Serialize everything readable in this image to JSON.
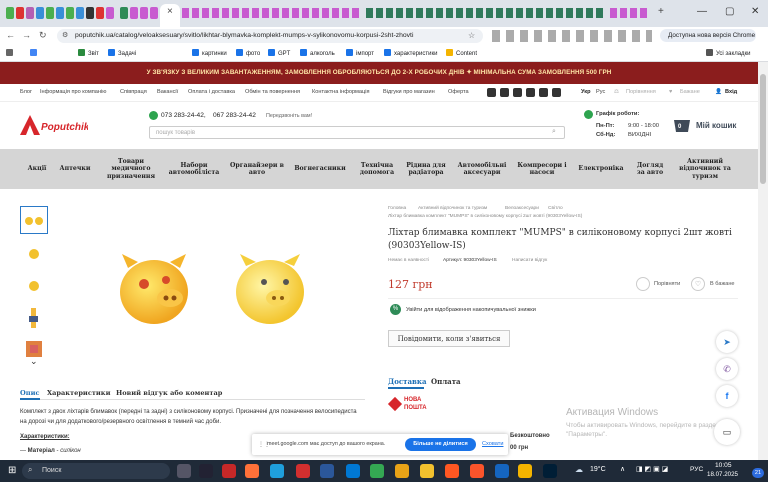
{
  "browser": {
    "url": "poputchik.ua/catalog/veloaksesuary/svitlo/likhtar-blymavka-komplekt-mumps-v-sylikonovomu-korpusi-2sht-zhovti",
    "chrome_banner": "Доступна нова версія Chrome",
    "bookmarks": [
      "Звіт",
      "Задачі",
      "картинки",
      "фото",
      "GPT",
      "алкоголь",
      "імпорт",
      "характеристики",
      "Content"
    ],
    "all_bookmarks": "Усі закладки"
  },
  "promo": {
    "text": "У ЗВ'ЯЗКУ З ВЕЛИКИМ ЗАВАНТАЖЕННЯМ, ЗАМОВЛЕННЯ ОБРОБЛЯЮТЬСЯ ДО 2-Х РОБОЧИХ ДНІВ ✦ МІНІМАЛЬНА СУМА ЗАМОВЛЕННЯ 500 ГРН"
  },
  "topnav": {
    "links": [
      "Блог",
      "Інформація про компанію",
      "Співпраця",
      "Вакансії",
      "Оплата і доставка",
      "Обмін та повернення",
      "Контактна інформація",
      "Відгуки про магазин",
      "Оферта"
    ],
    "lang_ua": "Укр",
    "lang_ru": "Рус",
    "compare": "Порівняння",
    "wishlist": "Бажане",
    "login": "Вхід"
  },
  "header": {
    "logo": "Poputchik.ua",
    "phone1": "073 283-24-42,",
    "phone2": "067 283-24-42",
    "callback": "Передзвоніть вам!",
    "search_placeholder": "пошук товарів",
    "schedule_title": "Графік роботи:",
    "sched_days1": "Пн-Пт:",
    "sched_time1": "9:00 - 18:00",
    "sched_days2": "Сб-Нд:",
    "sched_time2": "ВИХІДНІ",
    "cart_label": "Мій кошик",
    "cart_count": "0"
  },
  "categories": [
    "Акції",
    "Аптечки",
    "Товари медичного призначення",
    "Набори автомобіліста",
    "Органайзери в авто",
    "Вогнегасники",
    "Технічна допомога",
    "Рідина для радіатора",
    "Автомобільні аксесуари",
    "Компресори і насоси",
    "Електроніка",
    "Догляд за авто",
    "Активний відпочинок та туризм"
  ],
  "breadcrumb": [
    "Головна",
    "Активний відпочинок та туризм",
    "Велоаксесуари",
    "Світло",
    "Ліхтар блимавка комплект \"MUMPS\" в силіконовому корпусі 2шт жовті (90303Yellow-IS)"
  ],
  "product": {
    "title": "Ліхтар блимавка комплект \"MUMPS\" в силіконовому корпусі 2шт жовті (90303Yellow-IS)",
    "stock": "Немає в наявності",
    "sku": "Артикул: 90303Yellow-IS",
    "review_link": "Написати відгук",
    "price": "127 грн",
    "compare": "Порівняти",
    "wishlist": "В бажане",
    "discount_note": "Увійти для відображення накопичувальної знижки",
    "login_word": "Увійти",
    "notify_btn": "Повідомити, коли з'явиться",
    "delivery_tab": "Доставка",
    "payment_tab": "Оплата",
    "np_logo1": "НОВА",
    "np_logo2": "ПОШТА",
    "np_text1": "Безкоштовно",
    "np_text2": "00 грн"
  },
  "tabs": [
    "Опис",
    "Характеристики",
    "Новий відгук або коментар"
  ],
  "description": {
    "para": "Комплект з двох ліхтарів блимавок (передні та задні) з силіконовому корпусі. Призначені для позначення велосипедиста на дорозі чи для додаткового/резервного освітлення в темний час доби.",
    "features_title": "Характеристики:",
    "feature1_label": "Матеріал",
    "feature1_value": "силікон"
  },
  "cookie": {
    "text": "meet.google.com має доступ до вашого екрана.",
    "share_btn": "Більше не ділитися",
    "hide_link": "Сховати"
  },
  "watermark": {
    "title": "Активация Windows",
    "text": "Чтобы активировать Windows, перейдите в раздел \"Параметры\"."
  },
  "taskbar": {
    "search": "Поиск",
    "weather": "19°C",
    "lang": "РУС",
    "time": "10:05",
    "date": "18.07.2025",
    "notif_count": "21"
  }
}
